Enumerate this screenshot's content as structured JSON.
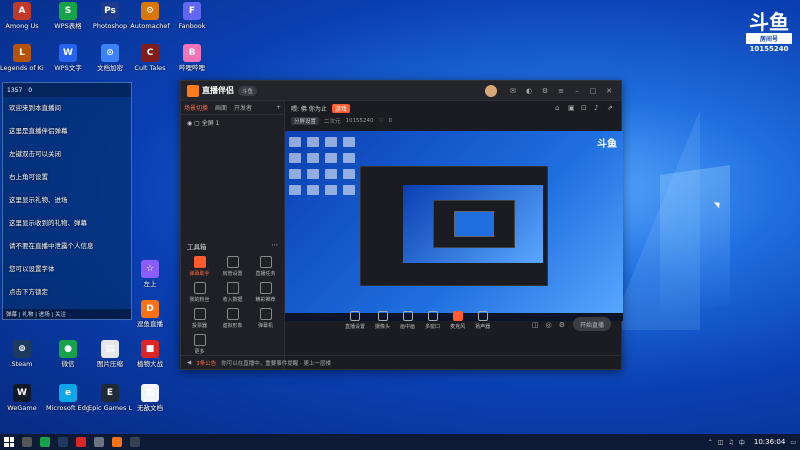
{
  "desktop": {
    "icons": [
      {
        "label": "Among Us",
        "color": "#c0392b",
        "glyph": "A"
      },
      {
        "label": "WPS表格",
        "color": "#17a34a",
        "glyph": "S"
      },
      {
        "label": "Photoshop",
        "color": "#1e3a8a",
        "glyph": "Ps"
      },
      {
        "label": "Automachef",
        "color": "#d97706",
        "glyph": "⚙"
      },
      {
        "label": "Fanbook",
        "color": "#6366f1",
        "glyph": "F"
      },
      {
        "label": "Legends of Kingdom",
        "color": "#b45309",
        "glyph": "L"
      },
      {
        "label": "WPS文字",
        "color": "#2563eb",
        "glyph": "W"
      },
      {
        "label": "文档加密",
        "color": "#3b82f6",
        "glyph": "⊙"
      },
      {
        "label": "Cult Tales",
        "color": "#7f1d1d",
        "glyph": "C"
      },
      {
        "label": "哔哩哔哩",
        "color": "#f472b6",
        "glyph": "B"
      },
      {
        "label": "Steam",
        "color": "#1e3a5f",
        "glyph": "⊚"
      },
      {
        "label": "微信",
        "color": "#16a34a",
        "glyph": "●"
      },
      {
        "label": "图片压缩",
        "color": "#e5e7eb",
        "glyph": "▤"
      },
      {
        "label": "植物大战",
        "color": "#dc2626",
        "glyph": "■"
      },
      {
        "label": "WeGame",
        "color": "#111827",
        "glyph": "W"
      },
      {
        "label": "Microsoft Edge",
        "color": "#0ea5e9",
        "glyph": "e"
      },
      {
        "label": "Epic Games Launcher",
        "color": "#1f2937",
        "glyph": "E"
      },
      {
        "label": "无敌文档",
        "color": "#f3f4f6",
        "glyph": "▥"
      },
      {
        "label": "逗鱼直播",
        "color": "#f97316",
        "glyph": "D"
      },
      {
        "label": "左上",
        "color": "#8b5cf6",
        "glyph": "☆"
      }
    ]
  },
  "douyu_badge": {
    "logo": "斗鱼",
    "room_label": "房间号",
    "room_number": "10155240"
  },
  "chat_overlay": {
    "top_stats": [
      "1357",
      "0"
    ],
    "messages": [
      "欢迎来到本直播间",
      "这里是直播伴侣弹幕",
      "左键双击可以关闭",
      "右上角可设置",
      "这里显示礼物、进场",
      "这里显示收到的礼物、弹幕",
      "请不要在直播中泄露个人信息",
      "您可以设置字体",
      "点击下方锁定"
    ],
    "bottom": "弹幕 | 礼物 | 进场 | 关注"
  },
  "app": {
    "brand": "直播伴侣",
    "version": "斗鱼",
    "scene_tabs": [
      "场景切换",
      "画面",
      "开发者"
    ],
    "scene_item": "全屏 1",
    "toolbox_title": "工具箱",
    "tools": [
      {
        "label": "弹幕助手",
        "hot": true
      },
      {
        "label": "房管设置",
        "hot": false
      },
      {
        "label": "直播任务",
        "hot": false
      },
      {
        "label": "我的粉丝",
        "hot": false
      },
      {
        "label": "收入数据",
        "hot": false
      },
      {
        "label": "精彩推荐",
        "hot": false
      },
      {
        "label": "投票器",
        "hot": false
      },
      {
        "label": "虚拟形象",
        "hot": false
      },
      {
        "label": "弹幕机",
        "hot": false
      },
      {
        "label": "更多",
        "hot": false
      }
    ],
    "room_title": "喂: 佛 你为止",
    "room_category": "游戏",
    "sub_tags": [
      "分屏设置",
      "二次元",
      "10155240",
      "0"
    ],
    "controls": [
      "直播设置",
      "摄像头",
      "画中画",
      "多窗口",
      "麦克风",
      "扬声器"
    ],
    "start_label": "开始直播",
    "status_notice": "3条公告",
    "status_text": "你可以在直播中，重要事件提醒 · 更上一层楼"
  },
  "taskbar": {
    "time": "10:36:04"
  }
}
